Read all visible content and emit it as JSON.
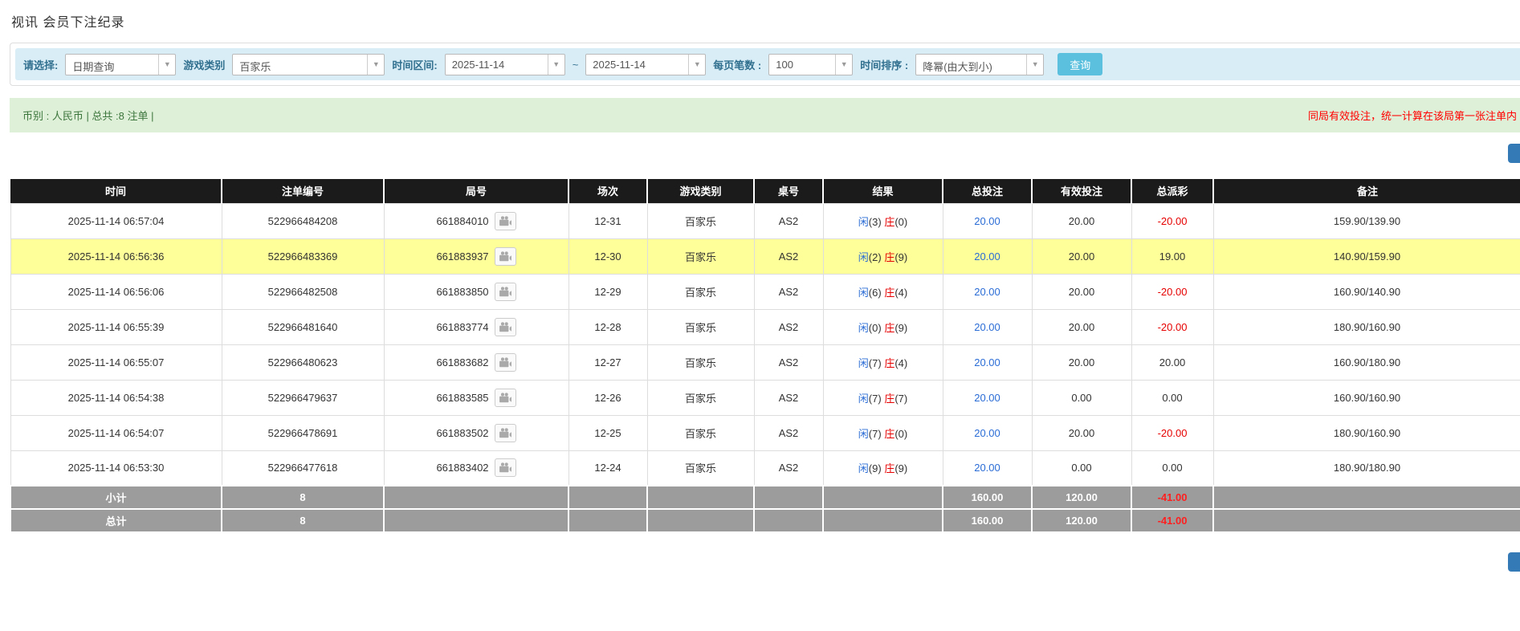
{
  "page": {
    "title": "视讯 会员下注纪录"
  },
  "filters": {
    "select_label": "请选择:",
    "select_value": "日期查询",
    "game_type_label": "游戏类别",
    "game_type_value": "百家乐",
    "time_range_label": "时间区间:",
    "time_from": "2025-11-14",
    "range_separator": "~",
    "time_to": "2025-11-14",
    "page_size_label": "每页笔数 :",
    "page_size_value": "100",
    "sort_label": "时间排序 :",
    "sort_value": "降幂(由大到小)",
    "search_button_label": "查询"
  },
  "summary": {
    "currency_info": "币别 : 人民币 | 总共 :8 注单 |",
    "notice": "同局有效投注，统一计算在该局第一张注单内"
  },
  "table": {
    "headers": [
      "时间",
      "注单编号",
      "局号",
      "场次",
      "游戏类别",
      "桌号",
      "结果",
      "总投注",
      "有效投注",
      "总派彩",
      "备注"
    ],
    "rows": [
      {
        "time": "2025-11-14 06:57:04",
        "bet_id": "522966484208",
        "round_id": "661884010",
        "session": "12-31",
        "game_type": "百家乐",
        "table_no": "AS2",
        "player": "闲",
        "player_score": "(3)",
        "banker": "庄",
        "banker_score": "(0)",
        "total_bet": "20.00",
        "valid_bet": "20.00",
        "payout": "-20.00",
        "remark": "159.90/139.90",
        "highlight": false
      },
      {
        "time": "2025-11-14 06:56:36",
        "bet_id": "522966483369",
        "round_id": "661883937",
        "session": "12-30",
        "game_type": "百家乐",
        "table_no": "AS2",
        "player": "闲",
        "player_score": "(2)",
        "banker": "庄",
        "banker_score": "(9)",
        "total_bet": "20.00",
        "valid_bet": "20.00",
        "payout": "19.00",
        "remark": "140.90/159.90",
        "highlight": true
      },
      {
        "time": "2025-11-14 06:56:06",
        "bet_id": "522966482508",
        "round_id": "661883850",
        "session": "12-29",
        "game_type": "百家乐",
        "table_no": "AS2",
        "player": "闲",
        "player_score": "(6)",
        "banker": "庄",
        "banker_score": "(4)",
        "total_bet": "20.00",
        "valid_bet": "20.00",
        "payout": "-20.00",
        "remark": "160.90/140.90",
        "highlight": false
      },
      {
        "time": "2025-11-14 06:55:39",
        "bet_id": "522966481640",
        "round_id": "661883774",
        "session": "12-28",
        "game_type": "百家乐",
        "table_no": "AS2",
        "player": "闲",
        "player_score": "(0)",
        "banker": "庄",
        "banker_score": "(9)",
        "total_bet": "20.00",
        "valid_bet": "20.00",
        "payout": "-20.00",
        "remark": "180.90/160.90",
        "highlight": false
      },
      {
        "time": "2025-11-14 06:55:07",
        "bet_id": "522966480623",
        "round_id": "661883682",
        "session": "12-27",
        "game_type": "百家乐",
        "table_no": "AS2",
        "player": "闲",
        "player_score": "(7)",
        "banker": "庄",
        "banker_score": "(4)",
        "total_bet": "20.00",
        "valid_bet": "20.00",
        "payout": "20.00",
        "remark": "160.90/180.90",
        "highlight": false
      },
      {
        "time": "2025-11-14 06:54:38",
        "bet_id": "522966479637",
        "round_id": "661883585",
        "session": "12-26",
        "game_type": "百家乐",
        "table_no": "AS2",
        "player": "闲",
        "player_score": "(7)",
        "banker": "庄",
        "banker_score": "(7)",
        "total_bet": "20.00",
        "valid_bet": "0.00",
        "payout": "0.00",
        "remark": "160.90/160.90",
        "highlight": false
      },
      {
        "time": "2025-11-14 06:54:07",
        "bet_id": "522966478691",
        "round_id": "661883502",
        "session": "12-25",
        "game_type": "百家乐",
        "table_no": "AS2",
        "player": "闲",
        "player_score": "(7)",
        "banker": "庄",
        "banker_score": "(0)",
        "total_bet": "20.00",
        "valid_bet": "20.00",
        "payout": "-20.00",
        "remark": "180.90/160.90",
        "highlight": false
      },
      {
        "time": "2025-11-14 06:53:30",
        "bet_id": "522966477618",
        "round_id": "661883402",
        "session": "12-24",
        "game_type": "百家乐",
        "table_no": "AS2",
        "player": "闲",
        "player_score": "(9)",
        "banker": "庄",
        "banker_score": "(9)",
        "total_bet": "20.00",
        "valid_bet": "0.00",
        "payout": "0.00",
        "remark": "180.90/180.90",
        "highlight": false
      }
    ],
    "footer": [
      {
        "label": "小计",
        "count": "8",
        "total_bet": "160.00",
        "valid_bet": "120.00",
        "payout": "-41.00"
      },
      {
        "label": "总计",
        "count": "8",
        "total_bet": "160.00",
        "valid_bet": "120.00",
        "payout": "-41.00"
      }
    ]
  },
  "colors": {
    "accent_blue": "#5bc0de",
    "link_blue": "#2a6cd5",
    "alert_red": "#ff0000",
    "success_green": "#3c763d",
    "header_black": "#1b1b1b",
    "footer_grey": "#9c9c9c",
    "highlight_yellow": "#ffff99"
  }
}
